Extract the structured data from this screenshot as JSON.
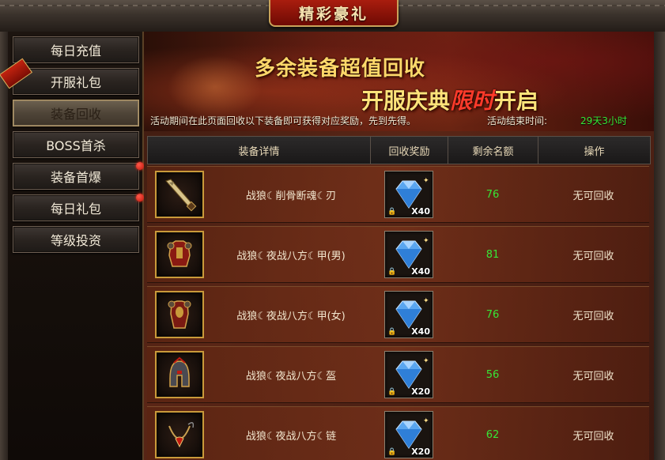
{
  "window_title": "精彩豪礼",
  "sidebar": {
    "corner_tag": "",
    "items": [
      {
        "label": "每日充值",
        "active": false,
        "dot": false
      },
      {
        "label": "开服礼包",
        "active": false,
        "dot": false
      },
      {
        "label": "装备回收",
        "active": true,
        "dot": false
      },
      {
        "label": "BOSS首杀",
        "active": false,
        "dot": false
      },
      {
        "label": "装备首爆",
        "active": false,
        "dot": true
      },
      {
        "label": "每日礼包",
        "active": false,
        "dot": true
      },
      {
        "label": "等级投资",
        "active": false,
        "dot": false
      }
    ]
  },
  "banner": {
    "line1": "多余装备超值回收",
    "line2_a": "开服庆典",
    "line2_highlight": "限时",
    "line2_b": "开启",
    "description": "活动期间在此页面回收以下装备即可获得对应奖励，先到先得。",
    "end_label": "活动结束时间:",
    "end_time": "29天3小时"
  },
  "table": {
    "headers": [
      "装备详情",
      "回收奖励",
      "剩余名额",
      "操作"
    ],
    "rows": [
      {
        "item": "战狼☾削骨断魂☾刃",
        "icon": "blade-icon",
        "reward_qty": "X40",
        "remaining": "76",
        "action": "无可回收"
      },
      {
        "item": "战狼☾夜战八方☾甲(男)",
        "icon": "armor-male-icon",
        "reward_qty": "X40",
        "remaining": "81",
        "action": "无可回收"
      },
      {
        "item": "战狼☾夜战八方☾甲(女)",
        "icon": "armor-female-icon",
        "reward_qty": "X40",
        "remaining": "76",
        "action": "无可回收"
      },
      {
        "item": "战狼☾夜战八方☾盔",
        "icon": "helmet-icon",
        "reward_qty": "X20",
        "remaining": "56",
        "action": "无可回收"
      },
      {
        "item": "战狼☾夜战八方☾链",
        "icon": "necklace-icon",
        "reward_qty": "X20",
        "remaining": "62",
        "action": "无可回收"
      }
    ]
  },
  "colors": {
    "remaining_text": "#37e637",
    "end_time_text": "#37e637",
    "banner_gold": "#ffd86a",
    "banner_highlight": "#ff3a2a",
    "item_border": "#c99a3a"
  }
}
